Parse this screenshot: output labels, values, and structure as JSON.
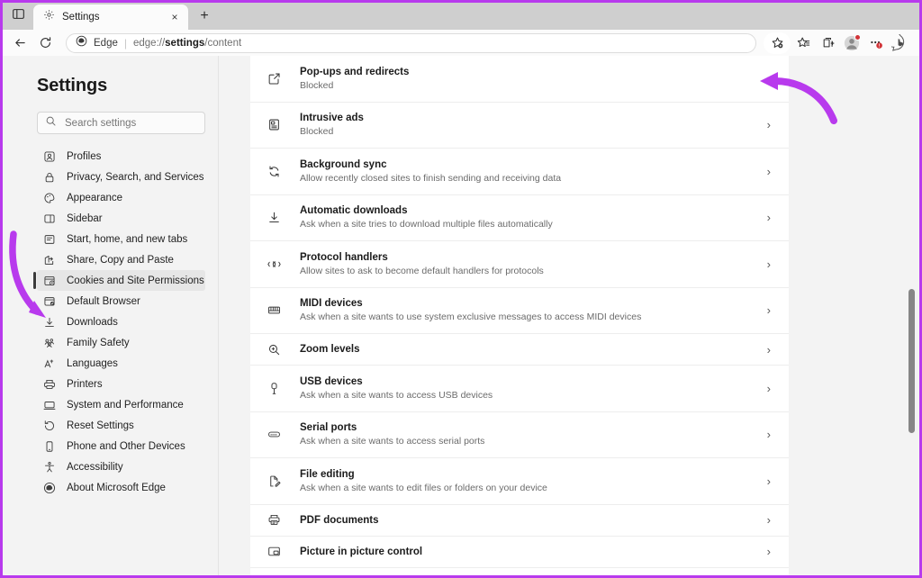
{
  "window": {
    "tab_sidebar_icon": "split-pane-icon",
    "tab_title": "Settings",
    "tab_favicon": "gear-icon",
    "tab_close": "×",
    "new_tab": "+"
  },
  "toolbar": {
    "back": "←",
    "refresh": "↻",
    "brand": "Edge",
    "separator": "|",
    "url_prefix": "edge://",
    "url_bold": "settings",
    "url_suffix": "/content",
    "right_icons": [
      {
        "name": "add-favorite-icon",
        "label": "favorite-star"
      },
      {
        "name": "favorites-list-icon",
        "label": "favorites"
      },
      {
        "name": "collections-icon",
        "label": "collections"
      },
      {
        "name": "profile-avatar-icon",
        "label": "profile"
      },
      {
        "name": "settings-more-icon",
        "label": "more"
      },
      {
        "name": "copilot-bing-icon",
        "label": "copilot"
      }
    ]
  },
  "sidebar": {
    "title": "Settings",
    "search_placeholder": "Search settings",
    "search_value": "",
    "search_icon": "search-icon",
    "items": [
      {
        "label": "Profiles",
        "icon": "profile-icon",
        "active": false
      },
      {
        "label": "Privacy, Search, and Services",
        "icon": "lock-icon",
        "active": false
      },
      {
        "label": "Appearance",
        "icon": "palette-icon",
        "active": false
      },
      {
        "label": "Sidebar",
        "icon": "sidebar-icon",
        "active": false
      },
      {
        "label": "Start, home, and new tabs",
        "icon": "home-page-icon",
        "active": false
      },
      {
        "label": "Share, Copy and Paste",
        "icon": "share-icon",
        "active": false
      },
      {
        "label": "Cookies and Site Permissions",
        "icon": "cookie-permissions-icon",
        "active": true
      },
      {
        "label": "Default Browser",
        "icon": "default-browser-icon",
        "active": false
      },
      {
        "label": "Downloads",
        "icon": "download-icon",
        "active": false
      },
      {
        "label": "Family Safety",
        "icon": "family-icon",
        "active": false
      },
      {
        "label": "Languages",
        "icon": "language-icon",
        "active": false
      },
      {
        "label": "Printers",
        "icon": "printer-icon",
        "active": false
      },
      {
        "label": "System and Performance",
        "icon": "monitor-icon",
        "active": false
      },
      {
        "label": "Reset Settings",
        "icon": "reset-icon",
        "active": false
      },
      {
        "label": "Phone and Other Devices",
        "icon": "phone-icon",
        "active": false
      },
      {
        "label": "Accessibility",
        "icon": "accessibility-icon",
        "active": false
      },
      {
        "label": "About Microsoft Edge",
        "icon": "edge-logo-icon",
        "active": false
      }
    ]
  },
  "content": {
    "chevron": "›",
    "rows": [
      {
        "title": "Pop-ups and redirects",
        "sub": "Blocked",
        "icon": "popup-external-link-icon"
      },
      {
        "title": "Intrusive ads",
        "sub": "Blocked",
        "icon": "ads-icon"
      },
      {
        "title": "Background sync",
        "sub": "Allow recently closed sites to finish sending and receiving data",
        "icon": "sync-icon"
      },
      {
        "title": "Automatic downloads",
        "sub": "Ask when a site tries to download multiple files automatically",
        "icon": "download-icon"
      },
      {
        "title": "Protocol handlers",
        "sub": "Allow sites to ask to become default handlers for protocols",
        "icon": "protocol-link-icon"
      },
      {
        "title": "MIDI devices",
        "sub": "Ask when a site wants to use system exclusive messages to access MIDI devices",
        "icon": "midi-keyboard-icon"
      },
      {
        "title": "Zoom levels",
        "sub": "",
        "icon": "zoom-magnifier-icon"
      },
      {
        "title": "USB devices",
        "sub": "Ask when a site wants to access USB devices",
        "icon": "usb-icon"
      },
      {
        "title": "Serial ports",
        "sub": "Ask when a site wants to access serial ports",
        "icon": "serial-port-icon"
      },
      {
        "title": "File editing",
        "sub": "Ask when a site wants to edit files or folders on your device",
        "icon": "file-edit-icon"
      },
      {
        "title": "PDF documents",
        "sub": "",
        "icon": "pdf-icon"
      },
      {
        "title": "Picture in picture control",
        "sub": "",
        "icon": "picture-in-picture-icon"
      }
    ]
  },
  "annotations": {
    "accent_color": "#b83aed",
    "arrows": [
      {
        "name": "arrow-to-popups-chevron",
        "points_to": "Pop-ups and redirects"
      },
      {
        "name": "arrow-to-cookies-sidebar-item",
        "points_to": "Cookies and Site Permissions"
      }
    ]
  },
  "scrollbar": {
    "name": "content-scrollbar"
  }
}
